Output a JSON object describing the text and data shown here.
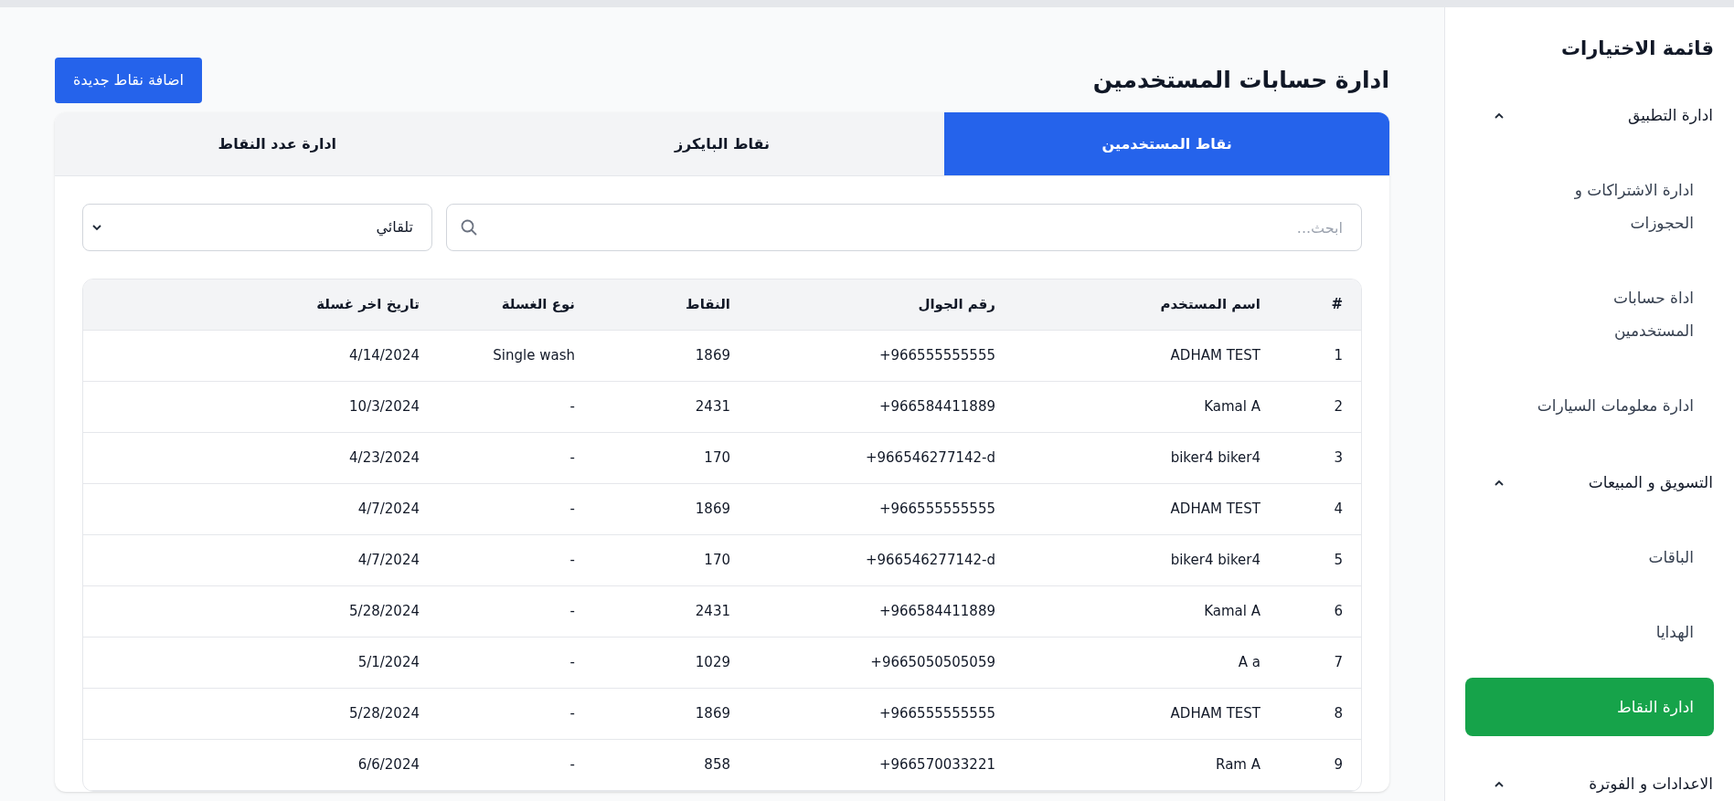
{
  "sidebar": {
    "title": "قائمة الاختيارات",
    "sections": [
      {
        "label": "ادارة التطبيق",
        "expanded": true,
        "items": [
          {
            "label": "ادارة الاشتراكات و الحجوزات",
            "selected": false
          },
          {
            "label": "اداة حسابات المستخدمين",
            "selected": false
          },
          {
            "label": "ادارة معلومات السيارات",
            "selected": false
          }
        ]
      },
      {
        "label": "التسويق و المبيعات",
        "expanded": true,
        "items": [
          {
            "label": "الباقات",
            "selected": false
          },
          {
            "label": "الهدايا",
            "selected": false
          },
          {
            "label": "ادارة النقاط",
            "selected": true
          }
        ]
      },
      {
        "label": "الاعدادات و الفوترة",
        "expanded": true
      }
    ]
  },
  "page": {
    "title": "ادارة حسابات المستخدمين",
    "add_button": "اضافة نقاط جديدة"
  },
  "tabs": [
    {
      "label": "نقاط المستخدمين",
      "selected": true
    },
    {
      "label": "نقاط البايكرز",
      "selected": false
    },
    {
      "label": "ادارة عدد النقاط",
      "selected": false
    }
  ],
  "search": {
    "placeholder": "ابحث..."
  },
  "sort_select": {
    "value": "تلقائي"
  },
  "table": {
    "columns": [
      "#",
      "اسم المستخدم",
      "رقم الجوال",
      "النقاط",
      "نوع الغسلة",
      "تاريخ اخر غسلة"
    ],
    "rows": [
      [
        "1",
        "ADHAM TEST",
        "+966555555555",
        "1869",
        "Single wash",
        "4/14/2024"
      ],
      [
        "2",
        "Kamal A",
        "+966584411889",
        "2431",
        "-",
        "10/3/2024"
      ],
      [
        "3",
        "biker4 biker4",
        "+966546277142-d",
        "170",
        "-",
        "4/23/2024"
      ],
      [
        "4",
        "ADHAM TEST",
        "+966555555555",
        "1869",
        "-",
        "4/7/2024"
      ],
      [
        "5",
        "biker4 biker4",
        "+966546277142-d",
        "170",
        "-",
        "4/7/2024"
      ],
      [
        "6",
        "Kamal A",
        "+966584411889",
        "2431",
        "-",
        "5/28/2024"
      ],
      [
        "7",
        "A a",
        "+9665050505059",
        "1029",
        "-",
        "5/1/2024"
      ],
      [
        "8",
        "ADHAM TEST",
        "+966555555555",
        "1869",
        "-",
        "5/28/2024"
      ],
      [
        "9",
        "Ram A",
        "+966570033221",
        "858",
        "-",
        "6/6/2024"
      ]
    ]
  }
}
